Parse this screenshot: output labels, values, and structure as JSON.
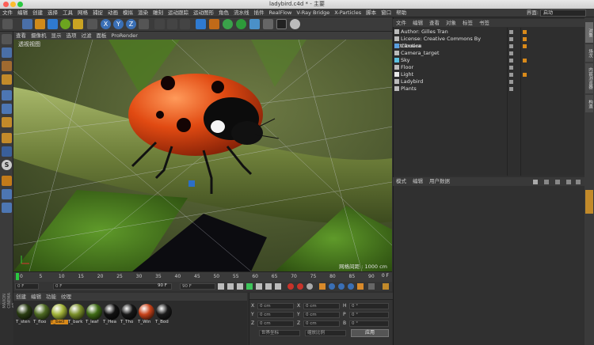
{
  "window": {
    "title": "ladybird.c4d * - 主要"
  },
  "menubar": {
    "items": [
      "文件",
      "编辑",
      "创建",
      "选择",
      "工具",
      "网格",
      "捕捉",
      "动画",
      "模拟",
      "渲染",
      "雕刻",
      "运动跟踪",
      "运动图形",
      "角色",
      "流水线",
      "插件",
      "RealFlow",
      "V-Ray Bridge",
      "X-Particles",
      "脚本",
      "窗口",
      "帮助"
    ]
  },
  "layout": {
    "label": "界面:",
    "value": "启动"
  },
  "viewport": {
    "menu": [
      "查看",
      "摄像机",
      "显示",
      "选项",
      "过滤",
      "面板",
      "ProRender"
    ],
    "label": "透视视图",
    "grid_spacing": "网格间距 : 1000 cm"
  },
  "timeline": {
    "ticks": [
      "0",
      "5",
      "10",
      "15",
      "20",
      "25",
      "30",
      "35",
      "40",
      "45",
      "50",
      "55",
      "60",
      "65",
      "70",
      "75",
      "80",
      "85",
      "90"
    ],
    "current_frame": "0 F",
    "start_field": "0 F",
    "min_field": "0 F",
    "end_field": "90 F",
    "max_field": "90 F"
  },
  "materials": {
    "menu": [
      "创建",
      "编辑",
      "功能",
      "纹理"
    ],
    "items": [
      {
        "label": "T_sten",
        "color": "#2a3d12"
      },
      {
        "label": "T_floo",
        "color": "#4e6a22"
      },
      {
        "label": "T_bacl",
        "color": "#a3b43a"
      },
      {
        "label": "T_bark",
        "color": "#7a8f2a"
      },
      {
        "label": "T_leaf",
        "color": "#3f6b16"
      },
      {
        "label": "T_Hea",
        "color": "#111111"
      },
      {
        "label": "T_Tho",
        "color": "#161616"
      },
      {
        "label": "T_Win",
        "color": "#c8431a"
      },
      {
        "label": "T_Bod",
        "color": "#1a1a1a"
      }
    ]
  },
  "coords": {
    "rows": [
      {
        "axis": "X",
        "pos": "0 cm",
        "size": "0 cm",
        "rot_label": "H",
        "rot": "0 °"
      },
      {
        "axis": "Y",
        "pos": "0 cm",
        "size": "0 cm",
        "rot_label": "P",
        "rot": "0 °"
      },
      {
        "axis": "Z",
        "pos": "0 cm",
        "size": "0 cm",
        "rot_label": "B",
        "rot": "0 °"
      }
    ],
    "world": "世界坐标",
    "scale": "缩放比例",
    "apply": "应用"
  },
  "objects": {
    "menu": [
      "文件",
      "编辑",
      "查看",
      "对象",
      "标签",
      "书签"
    ],
    "rows": [
      {
        "name": "Author: Gilles Tran",
        "indent": 0
      },
      {
        "name": "License: Creative Commons By Attribution",
        "indent": 0
      },
      {
        "name": "Camera",
        "indent": 0
      },
      {
        "name": "Camera_target",
        "indent": 0
      },
      {
        "name": "Sky",
        "indent": 0
      },
      {
        "name": "Floor",
        "indent": 0
      },
      {
        "name": "Light",
        "indent": 0
      },
      {
        "name": "Ladybird",
        "indent": 0
      },
      {
        "name": "Plants",
        "indent": 0
      }
    ]
  },
  "attributes": {
    "menu": [
      "模式",
      "编辑",
      "用户数据"
    ]
  },
  "right_tabs": [
    "对象",
    "场次",
    "内容浏览器",
    "构造"
  ],
  "brand": "MAXON CINEMA 4D"
}
